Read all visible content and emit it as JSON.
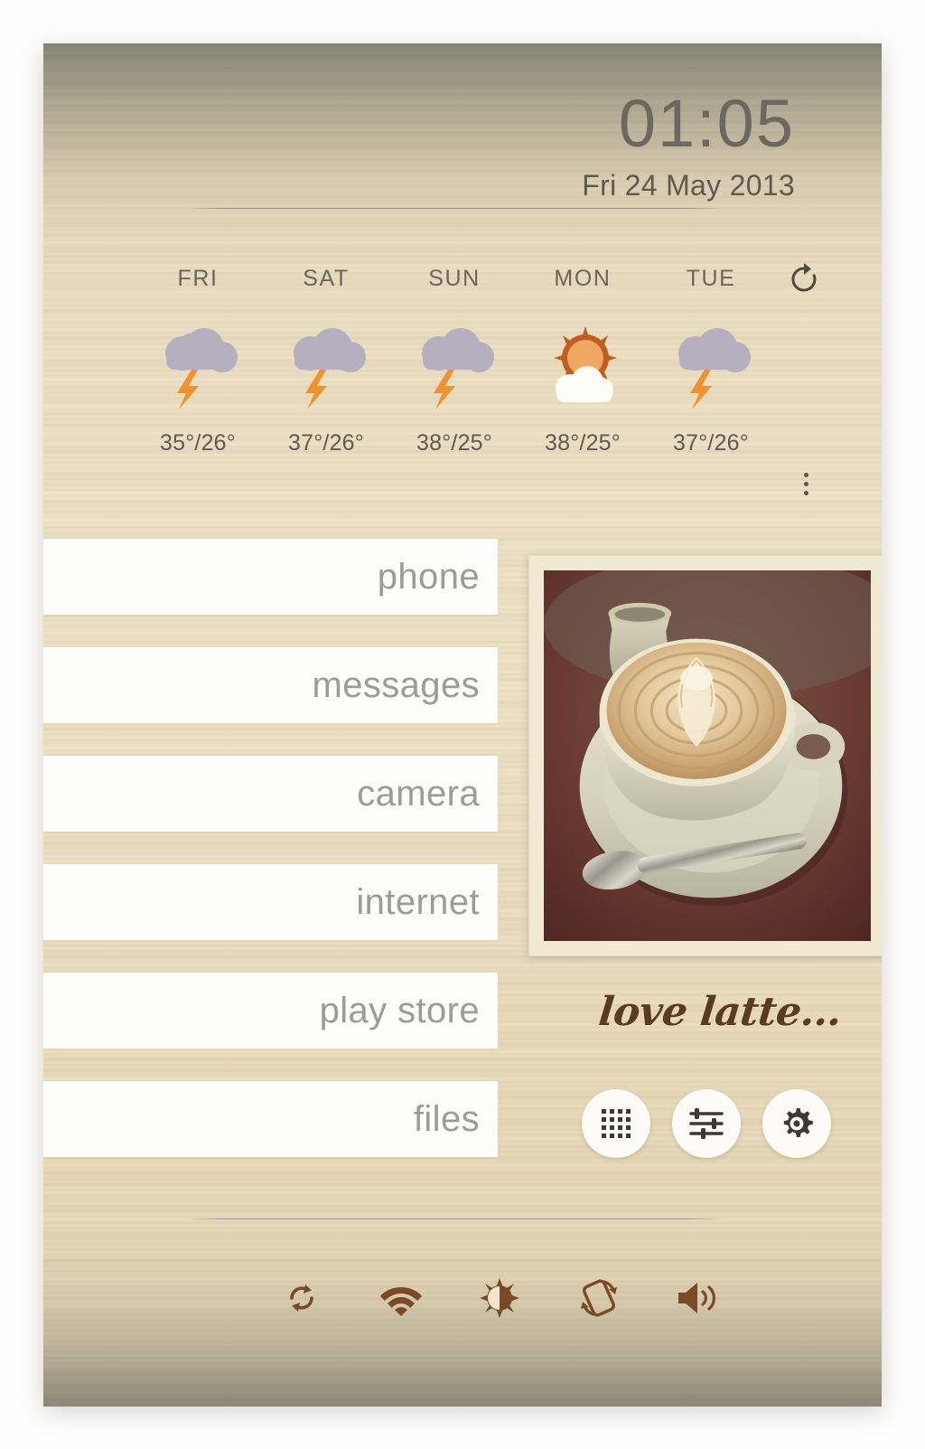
{
  "clock": {
    "time": "01:05",
    "date": "Fri 24 May 2013"
  },
  "weather": {
    "refresh_icon": "refresh-icon",
    "more_icon": "overflow-menu-icon",
    "days": [
      {
        "day": "FRI",
        "icon": "thunderstorm-icon",
        "temps": "35°/26°",
        "high": "35°",
        "low": "26°"
      },
      {
        "day": "SAT",
        "icon": "thunderstorm-icon",
        "temps": "37°/26°",
        "high": "37°",
        "low": "26°"
      },
      {
        "day": "SUN",
        "icon": "thunderstorm-icon",
        "temps": "38°/25°",
        "high": "38°",
        "low": "25°"
      },
      {
        "day": "MON",
        "icon": "sun-behind-cloud-icon",
        "temps": "38°/25°",
        "high": "38°",
        "low": "25°"
      },
      {
        "day": "TUE",
        "icon": "thunderstorm-icon",
        "temps": "37°/26°",
        "high": "37°",
        "low": "26°"
      }
    ]
  },
  "apps": [
    {
      "label": "phone"
    },
    {
      "label": "messages"
    },
    {
      "label": "camera"
    },
    {
      "label": "internet"
    },
    {
      "label": "play store"
    },
    {
      "label": "files"
    }
  ],
  "photo_widget": {
    "caption": "love latte...",
    "subject": "latte-coffee-cup-photo"
  },
  "dock": [
    {
      "icon": "app-drawer-grid-icon",
      "label": "app drawer"
    },
    {
      "icon": "sliders-icon",
      "label": "settings sliders"
    },
    {
      "icon": "gear-icon",
      "label": "settings"
    }
  ],
  "toggles": [
    {
      "icon": "sync-icon",
      "label": "sync"
    },
    {
      "icon": "wifi-icon",
      "label": "wi-fi"
    },
    {
      "icon": "brightness-icon",
      "label": "brightness"
    },
    {
      "icon": "auto-rotate-icon",
      "label": "auto rotate"
    },
    {
      "icon": "volume-icon",
      "label": "volume"
    }
  ],
  "colors": {
    "cloud": "#b5afc0",
    "bolt": "#f0922f",
    "sun_core": "#efa762",
    "sun_ray": "#c05e21",
    "text_light": "#9b9b9b",
    "toggle_brown": "#7a4a28",
    "caption_brown": "#5b3a22",
    "wallpaper": "#efe3c8"
  }
}
